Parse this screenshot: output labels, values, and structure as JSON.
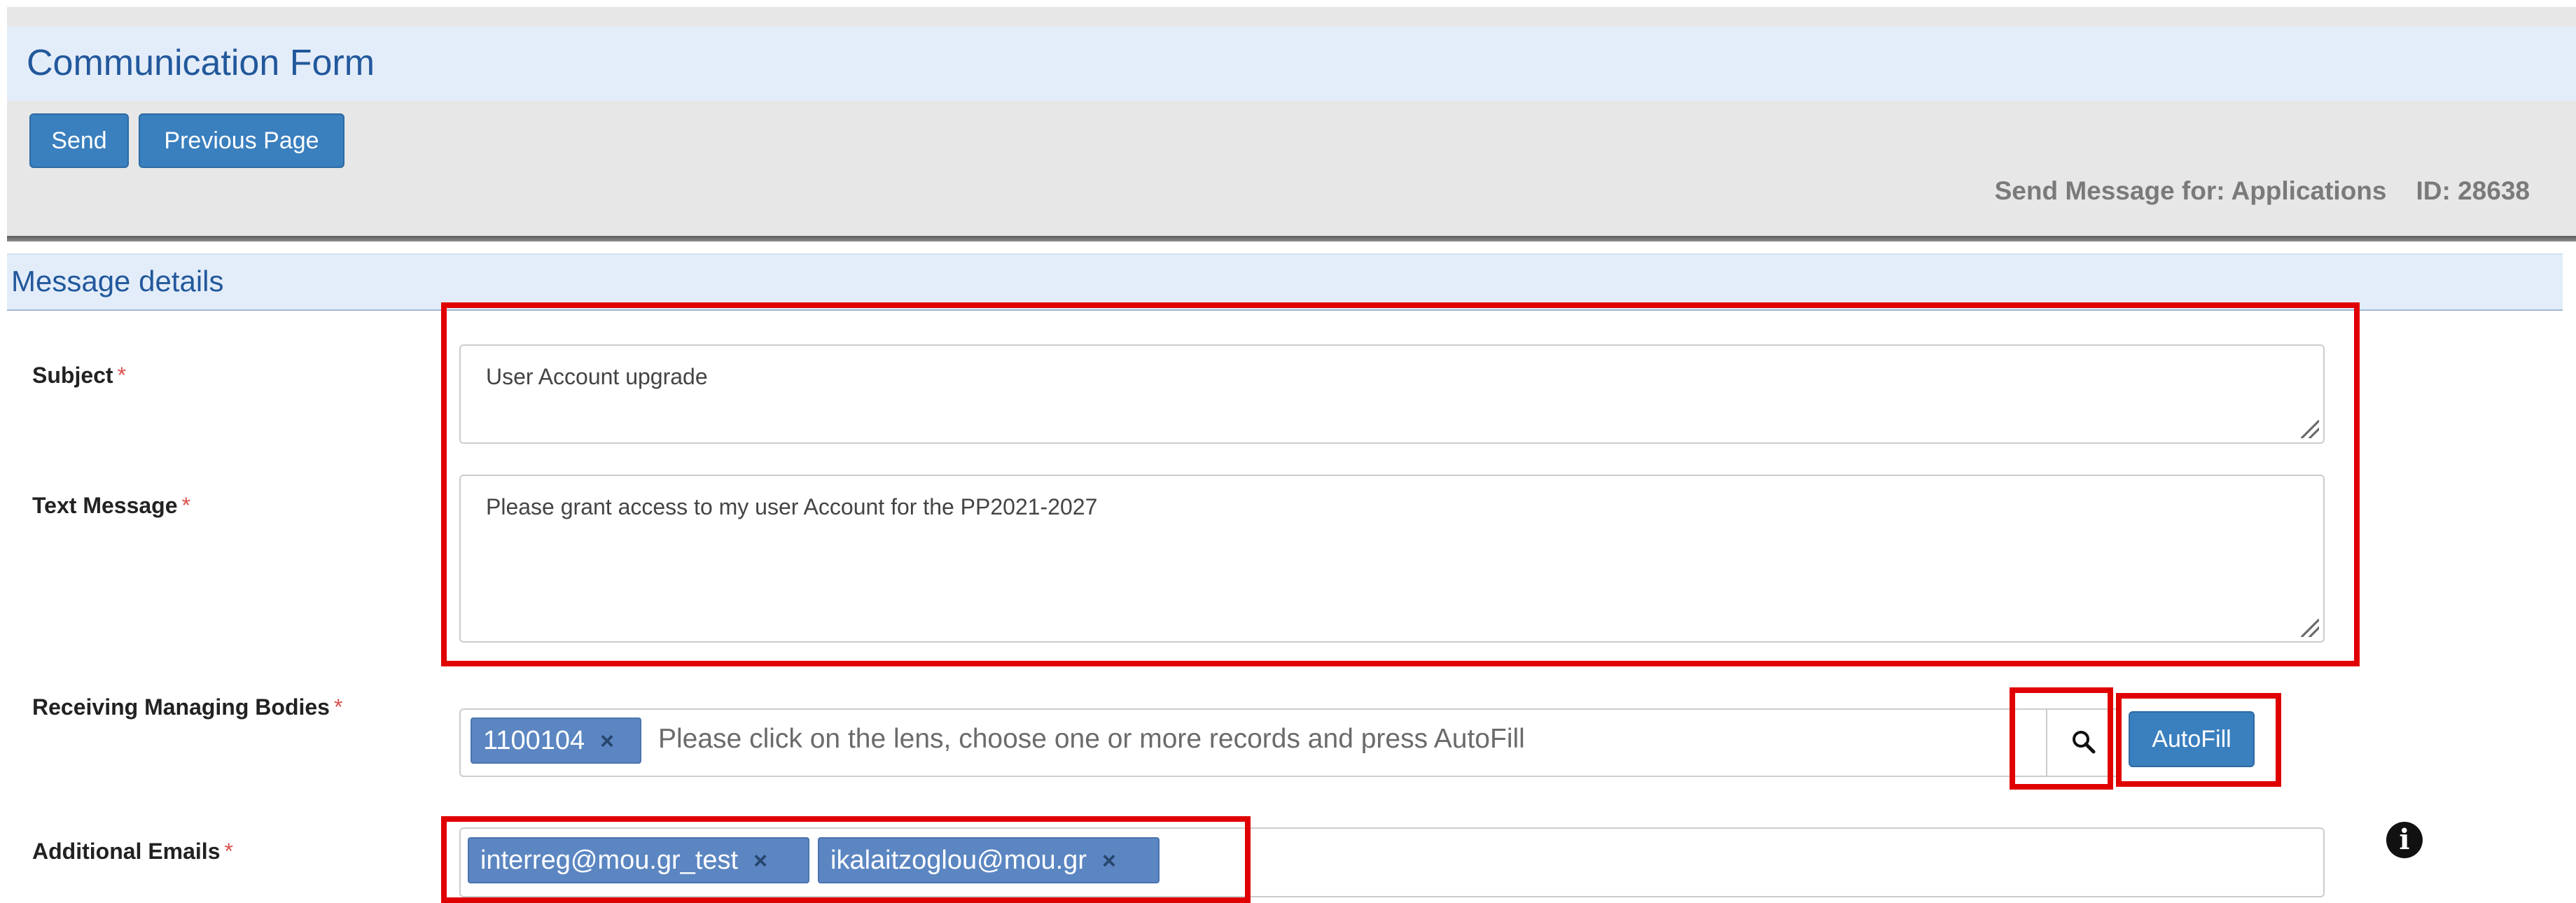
{
  "header": {
    "title": "Communication Form",
    "buttons": {
      "send": "Send",
      "previous_page": "Previous Page"
    },
    "send_for_label": "Send Message for: Applications",
    "id_label": "ID: 28638"
  },
  "section": {
    "title": "Message details"
  },
  "form": {
    "required_mark": "*",
    "subject": {
      "label": "Subject",
      "value": "User Account upgrade"
    },
    "text_message": {
      "label": "Text Message",
      "value": "Please grant access to my user Account for the PP2021-2027"
    },
    "receiving_bodies": {
      "label": "Receiving Managing Bodies",
      "tags": [
        "1100104"
      ],
      "placeholder": "Please click on the lens, choose one or more records and press AutoFill",
      "autofill_label": "AutoFill"
    },
    "additional_emails": {
      "label": "Additional Emails",
      "tags": [
        "interreg@mou.gr_test",
        "ikalaitzoglou@mou.gr"
      ]
    },
    "tag_remove_glyph": "×"
  },
  "icons": {
    "lens": "search-icon",
    "info": "info-icon"
  },
  "colors": {
    "primary_button": "#3a7fbe",
    "title_text": "#22589c",
    "tag_bg": "#5b86c2",
    "highlight_red": "#e00000",
    "required_star": "#d9534f"
  }
}
